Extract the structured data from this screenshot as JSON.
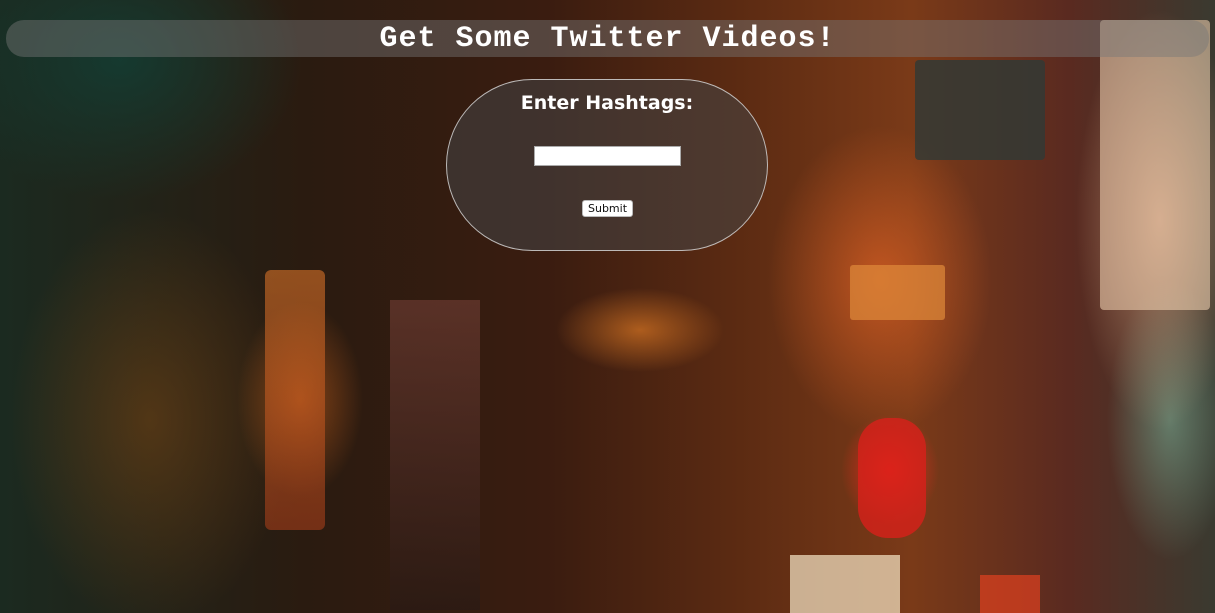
{
  "header": {
    "title": "Get Some Twitter Videos!"
  },
  "form": {
    "label": "Enter Hashtags:",
    "hashtag_value": "",
    "hashtag_placeholder": "",
    "submit_label": "Submit"
  },
  "background": {
    "icon": "neon-alley-painting"
  }
}
